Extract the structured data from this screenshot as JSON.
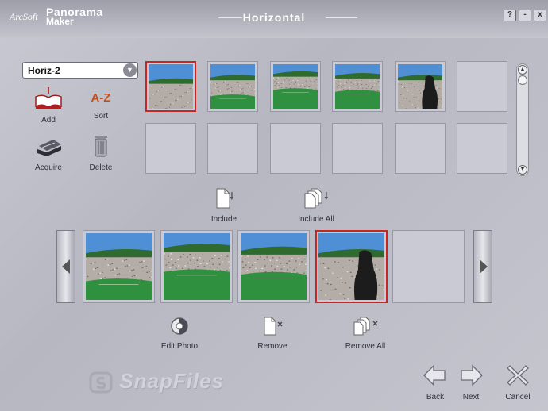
{
  "window": {
    "brand": "ArcSoft",
    "product_line1": "Panorama",
    "product_line2": "Maker",
    "title": "Horizontal",
    "controls": [
      "?",
      "-",
      "x"
    ]
  },
  "album": {
    "selected": "Horiz-2"
  },
  "tools": {
    "add": "Add",
    "sort": "Sort",
    "acquire": "Acquire",
    "delete": "Delete",
    "sort_icon_text": "A-Z"
  },
  "include": {
    "include": "Include",
    "include_all": "Include All"
  },
  "edit": {
    "edit_photo": "Edit Photo",
    "remove": "Remove",
    "remove_all": "Remove All"
  },
  "watermark": "SnapFiles",
  "actions": {
    "back": "Back",
    "next": "Next",
    "cancel": "Cancel"
  },
  "album_grid": {
    "cells": [
      {
        "photo": "stadium-1",
        "selected": true
      },
      {
        "photo": "stadium-2",
        "selected": false
      },
      {
        "photo": "stadium-3",
        "selected": false
      },
      {
        "photo": "stadium-4",
        "selected": false
      },
      {
        "photo": "stadium-5",
        "selected": false
      },
      {
        "photo": null,
        "selected": false
      },
      {
        "photo": null,
        "selected": false
      },
      {
        "photo": null,
        "selected": false
      },
      {
        "photo": null,
        "selected": false
      },
      {
        "photo": null,
        "selected": false
      },
      {
        "photo": null,
        "selected": false
      },
      {
        "photo": null,
        "selected": false
      }
    ]
  },
  "stitch_strip": {
    "cells": [
      {
        "photo": "stadium-2",
        "selected": false
      },
      {
        "photo": "stadium-3",
        "selected": false
      },
      {
        "photo": "stadium-4",
        "selected": false
      },
      {
        "photo": "stadium-5",
        "selected": true
      },
      {
        "photo": null,
        "selected": false
      }
    ]
  },
  "colors": {
    "selection": "#c82525",
    "sky": "#4f8fd6",
    "field": "#2f9040",
    "crowd": "#b4aca6"
  }
}
